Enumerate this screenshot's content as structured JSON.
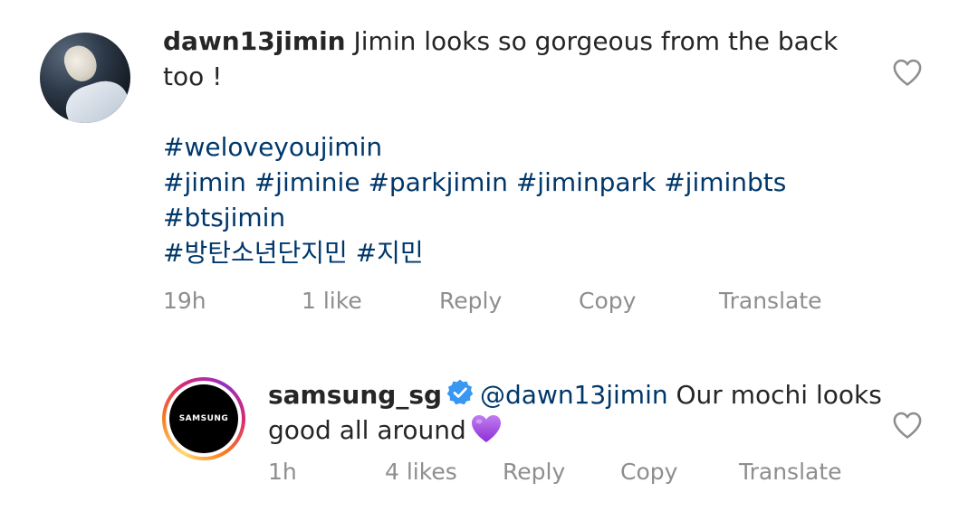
{
  "comments": [
    {
      "username": "dawn13jimin",
      "text_line": "Jimin looks so gorgeous from the back too !",
      "hashtag_lines": [
        "#weloveyoujimin",
        "#jimin #jiminie #parkjimin #jiminpark #jiminbts",
        "#btsjimin",
        "#방탄소년단지민 #지민"
      ],
      "time": "19h",
      "likes": "1 like",
      "reply": "Reply",
      "copy": "Copy",
      "translate": "Translate",
      "like_icon": "heart-outline-icon"
    },
    {
      "username": "samsung_sg",
      "verified": true,
      "avatar_logo_text": "SAMSUNG",
      "mention": "@dawn13jimin",
      "text": "Our mochi looks good all around",
      "emoji": "purple-heart",
      "time": "1h",
      "likes": "4 likes",
      "reply": "Reply",
      "copy": "Copy",
      "translate": "Translate",
      "like_icon": "heart-outline-icon"
    }
  ],
  "colors": {
    "text": "#262626",
    "secondary": "#8e8e8e",
    "link": "#00376b",
    "verified_badge": "#3897f0",
    "emoji_purple": "#a64ae6"
  }
}
